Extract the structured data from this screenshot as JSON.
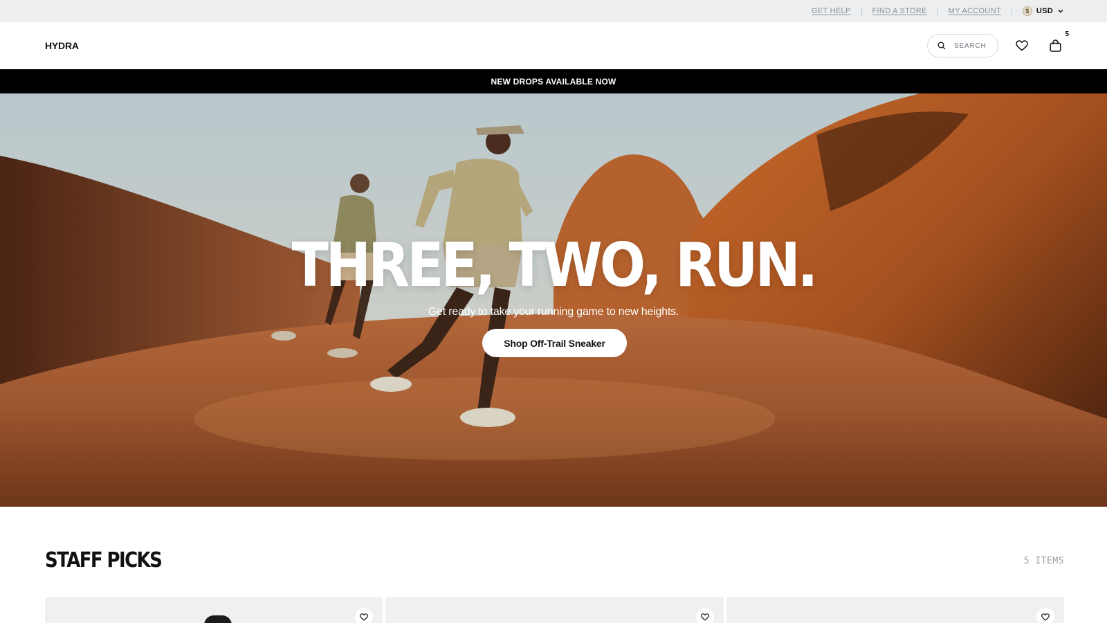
{
  "utility": {
    "links": [
      "GET HELP",
      "FIND A STORE",
      "MY ACCOUNT"
    ],
    "currency_symbol": "$",
    "currency": "USD"
  },
  "header": {
    "logo": "HYDRA",
    "search_placeholder": "SEARCH",
    "bag_count": "5"
  },
  "announcement": "NEW DROPS AVAILABLE NOW",
  "hero": {
    "title": "THREE, TWO, RUN.",
    "subtitle": "Get ready to take your running game to new heights.",
    "cta": "Shop Off-Trail Sneaker"
  },
  "staff_picks": {
    "title": "STAFF PICKS",
    "count": "5 ITEMS"
  },
  "icons": {
    "search": "search-icon",
    "wishlist": "heart-icon",
    "bag": "shopping-bag-icon",
    "currency_dropdown": "chevron-down-icon"
  },
  "colors": {
    "utility_bg": "#eceef0",
    "announcement_bg": "#000000",
    "card_bg": "#eef0f2",
    "muted_text": "#8a8f96"
  }
}
